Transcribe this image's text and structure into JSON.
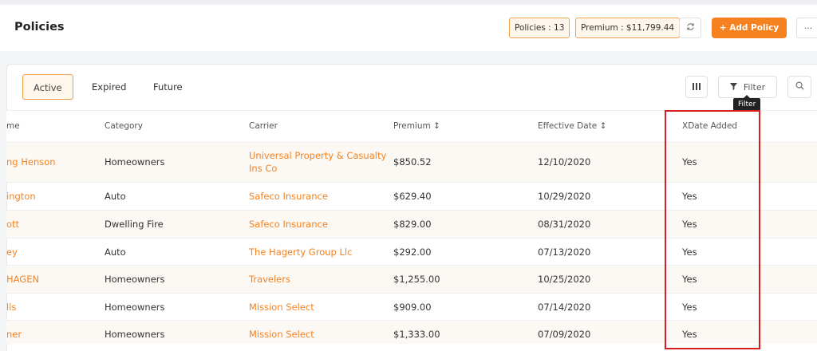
{
  "header": {
    "title": "Policies",
    "policies_pill": "Policies : 13",
    "premium_pill": "Premium : $11,799.44",
    "refresh_icon": "refresh-icon",
    "add_label": "+ Add Policy",
    "more_label": "···"
  },
  "tabs": [
    {
      "label": "Active",
      "active": true
    },
    {
      "label": "Expired",
      "active": false
    },
    {
      "label": "Future",
      "active": false
    }
  ],
  "toolbar": {
    "columns_icon": "columns-icon",
    "filter_label": "Filter",
    "filter_icon": "funnel-icon",
    "search_icon": "search-icon",
    "tooltip": "Filter"
  },
  "columns": [
    "me",
    "Category",
    "Carrier",
    "Premium ↕",
    "Effective Date ↕",
    "XDate Added"
  ],
  "rows": [
    {
      "name": "ng Henson",
      "category": "Homeowners",
      "carrier": "Universal Property & Casualty Ins Co",
      "premium": "$850.52",
      "date": "12/10/2020",
      "xdate": "Yes"
    },
    {
      "name": "ington",
      "category": "Auto",
      "carrier": "Safeco Insurance",
      "premium": "$629.40",
      "date": "10/29/2020",
      "xdate": "Yes"
    },
    {
      "name": "ott",
      "category": "Dwelling Fire",
      "carrier": "Safeco Insurance",
      "premium": "$829.00",
      "date": "08/31/2020",
      "xdate": "Yes"
    },
    {
      "name": "ey",
      "category": "Auto",
      "carrier": "The Hagerty Group Llc",
      "premium": "$292.00",
      "date": "07/13/2020",
      "xdate": "Yes"
    },
    {
      "name": "HAGEN",
      "category": "Homeowners",
      "carrier": "Travelers",
      "premium": "$1,255.00",
      "date": "10/25/2020",
      "xdate": "Yes"
    },
    {
      "name": "lls",
      "category": "Homeowners",
      "carrier": "Mission Select",
      "premium": "$909.00",
      "date": "07/14/2020",
      "xdate": "Yes"
    },
    {
      "name": "ner",
      "category": "Homeowners",
      "carrier": "Mission Select",
      "premium": "$1,333.00",
      "date": "07/09/2020",
      "xdate": "Yes"
    }
  ],
  "colors": {
    "accent": "#f5821f",
    "highlight": "#d62020"
  }
}
